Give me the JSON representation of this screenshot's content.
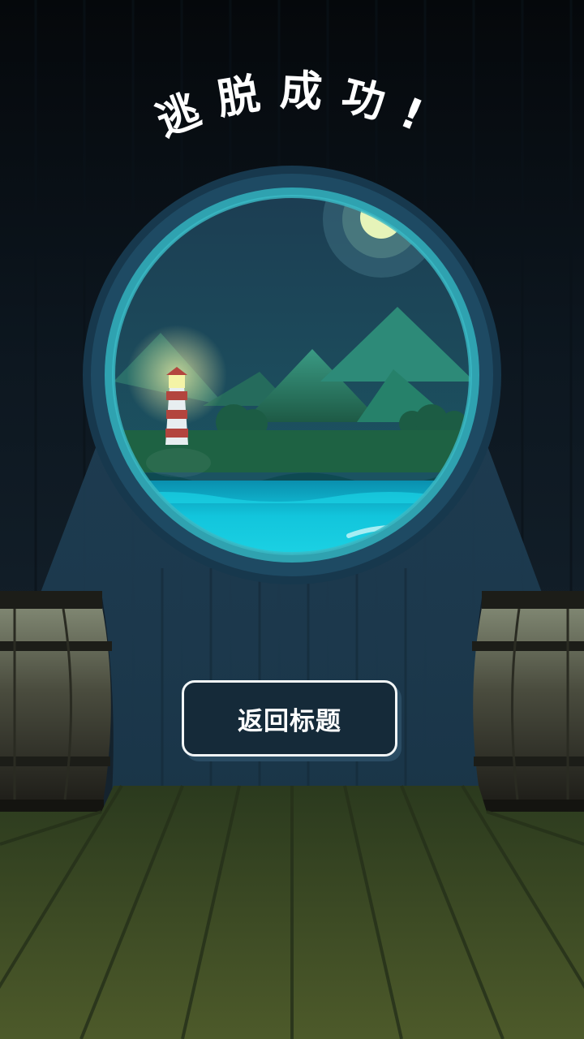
{
  "screen": {
    "title": "逃脱成功!",
    "return_button_label": "返回标题"
  },
  "scene": {
    "window_view_elements": [
      "moon",
      "mountains",
      "lighthouse",
      "trees",
      "sea"
    ]
  },
  "colors": {
    "wall": "#14212d",
    "porthole_rim": "#1e4a63",
    "porthole_ring": "#2fa2b0",
    "sky": "#1a4355",
    "mountain": "#2c7a6a",
    "sea": "#12c5dc",
    "floor": "#3d4a24",
    "button_bg": "#152a39",
    "button_border": "#f2f6f7"
  }
}
